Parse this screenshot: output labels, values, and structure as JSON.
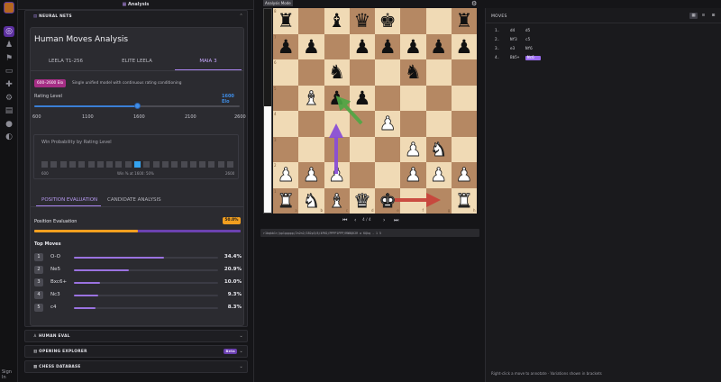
{
  "header": {
    "icon_label": "Analysis",
    "mode_badge": "Analysis Mode"
  },
  "rail": {
    "sign_in": "Sign In"
  },
  "neural_nets": {
    "section_title": "NEURAL NETS",
    "panel_title": "Human Moves Analysis",
    "tabs": [
      "LEELA T1-256",
      "ELITE LEELA",
      "MAIA 3"
    ],
    "active_tab": "MAIA 3",
    "elo_badge": "600–2600 Elo",
    "model_description": "Single unified model with continuous rating conditioning",
    "rating_label": "Rating Level",
    "rating_value": "1600 Elo",
    "rating_fraction": 0.5,
    "rating_ticks": [
      "600",
      "1100",
      "1600",
      "2100",
      "2600"
    ],
    "win_probability": {
      "title": "Win Probability by Rating Level",
      "min": "600",
      "max": "2600",
      "caption": "Win % at 1600: 50%",
      "cells": 21,
      "highlight_index": 10
    },
    "subtabs": [
      "POSITION EVALUATION",
      "CANDIDATE ANALYSIS"
    ],
    "position_eval_label": "Position Evaluation",
    "position_eval_value": "50.0%",
    "position_eval_fraction": 0.5,
    "top_moves_label": "Top Moves",
    "top_moves": [
      {
        "rank": "1",
        "move": "O-O",
        "pct": "34.4%",
        "value": 34.4
      },
      {
        "rank": "2",
        "move": "Ne5",
        "pct": "20.9%",
        "value": 20.9
      },
      {
        "rank": "3",
        "move": "Bxc6+",
        "pct": "10.0%",
        "value": 10.0
      },
      {
        "rank": "4",
        "move": "Nc3",
        "pct": "9.3%",
        "value": 9.3
      },
      {
        "rank": "5",
        "move": "c4",
        "pct": "8.3%",
        "value": 8.3
      }
    ]
  },
  "sections": {
    "human_eval": "HUMAN EVAL",
    "opening_explorer": "OPENING EXPLORER",
    "opening_badge": "Beta",
    "chess_database": "CHESS DATABASE"
  },
  "board": {
    "white_fraction": 0.52,
    "nav_text": "4 / 4",
    "fen": "r1bqkb1r/pp1ppppp/2n2n2/1B2p3/8/4PN2/PPPP1PPP/RNBQK2R w KQkq - 1 5",
    "rank_labels": [
      "8",
      "7",
      "6",
      "5",
      "4",
      "3",
      "2",
      "1"
    ],
    "file_labels": [
      "a",
      "b",
      "c",
      "d",
      "e",
      "f",
      "g",
      "h"
    ]
  },
  "moves_panel": {
    "title": "MOVES",
    "lines": [
      {
        "num": "1.",
        "white": "d4",
        "black": "d5"
      },
      {
        "num": "2.",
        "white": "Nf3",
        "black": "c5"
      },
      {
        "num": "3.",
        "white": "e3",
        "black": "Nf6"
      },
      {
        "num": "4.",
        "white": "Bb5+",
        "black": "Nc6"
      }
    ],
    "footer": "Right-click a move to annotate · Variations shown in brackets"
  }
}
